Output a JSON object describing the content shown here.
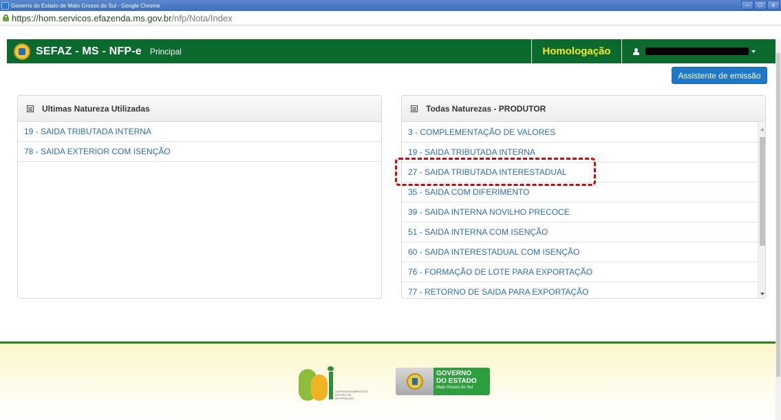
{
  "window": {
    "title": "Governo do Estado de Mato Grosso do Sul - Google Chrome",
    "buttons": {
      "minimize": "–",
      "maximize": "□",
      "close": "x"
    }
  },
  "browser": {
    "url_host": "https://hom.servicos.efazenda.ms.gov.br",
    "url_path": "/nfp/Nota/Index"
  },
  "navbar": {
    "brand": "SEFAZ - MS - NFP-e",
    "principal": "Principal",
    "environment": "Homologação"
  },
  "toolbar": {
    "assist_label": "Assistente de emissão"
  },
  "panels": {
    "recent": {
      "heading": "Ultimas Natureza Utilizadas",
      "items": [
        "19 - SAIDA TRIBUTADA INTERNA",
        "78 - SAIDA EXTERIOR COM ISENÇÃO"
      ]
    },
    "all": {
      "heading": "Todas Naturezas - PRODUTOR",
      "items": [
        "3 - COMPLEMENTAÇÃO DE VALORES",
        "19 - SAIDA TRIBUTADA INTERNA",
        "27 - SAIDA TRIBUTADA INTERESTADUAL",
        "35 - SAIDA COM DIFERIMENTO",
        "39 - SAIDA INTERNA NOVILHO PRECOCE",
        "51 - SAIDA INTERNA COM ISENÇÃO",
        "60 - SAIDA INTERESTADUAL COM ISENÇÃO",
        "76 - FORMAÇÃO DE LOTE PARA EXPORTAÇÃO",
        "77 - RETORNO DE SAIDA PARA EXPORTAÇÃO"
      ]
    }
  },
  "footer": {
    "sgi_caption": "SUPERINTENDÊNCIA DE GESTÃO DA INFORMAÇÃO",
    "gov_line1a": "GOVERNO",
    "gov_line1b": "DO ESTADO",
    "gov_line2": "Mato Grosso do Sul"
  },
  "colors": {
    "navbar_green": "#0b6b2e",
    "environment_yellow": "#f5ea1b",
    "link_blue": "#2a6ebb",
    "button_blue": "#1f79c9",
    "highlight_red": "#e00000"
  }
}
